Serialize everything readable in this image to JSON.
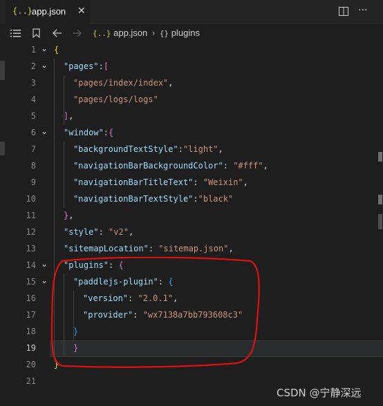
{
  "tab": {
    "icon": "json-braces-icon",
    "braces": "{..}",
    "filename": "app.json",
    "close": "✕"
  },
  "toolbar": {
    "split_icon": "split-editor-icon",
    "more": "···"
  },
  "breadcrumb": {
    "file_icon": "{..}",
    "file": "app.json",
    "symbol_icon": "{}",
    "symbol": "plugins"
  },
  "watermark": "CSDN @宁静深远",
  "highlight_color": "#e01010",
  "lines": [
    {
      "n": "1",
      "parts": [
        {
          "t": "{",
          "c": "b1"
        }
      ]
    },
    {
      "n": "2",
      "parts": [
        {
          "t": "\"pages\"",
          "c": "k"
        },
        {
          "t": ":",
          "c": "p"
        },
        {
          "t": "[",
          "c": "b2"
        }
      ]
    },
    {
      "n": "3",
      "parts": [
        {
          "t": "\"pages/index/index\"",
          "c": "s"
        },
        {
          "t": ",",
          "c": "p"
        }
      ]
    },
    {
      "n": "4",
      "parts": [
        {
          "t": "\"pages/logs/logs\"",
          "c": "s"
        }
      ]
    },
    {
      "n": "5",
      "parts": [
        {
          "t": "]",
          "c": "b2"
        },
        {
          "t": ",",
          "c": "p"
        }
      ]
    },
    {
      "n": "6",
      "parts": [
        {
          "t": "\"window\"",
          "c": "k"
        },
        {
          "t": ":",
          "c": "p"
        },
        {
          "t": "{",
          "c": "b2"
        }
      ]
    },
    {
      "n": "7",
      "parts": [
        {
          "t": "\"backgroundTextStyle\"",
          "c": "k"
        },
        {
          "t": ":",
          "c": "p"
        },
        {
          "t": "\"light\"",
          "c": "s"
        },
        {
          "t": ",",
          "c": "p"
        }
      ]
    },
    {
      "n": "8",
      "parts": [
        {
          "t": "\"navigationBarBackgroundColor\"",
          "c": "k"
        },
        {
          "t": ": ",
          "c": "p"
        },
        {
          "t": "\"#fff\"",
          "c": "s"
        },
        {
          "t": ",",
          "c": "p"
        }
      ]
    },
    {
      "n": "9",
      "parts": [
        {
          "t": "\"navigationBarTitleText\"",
          "c": "k"
        },
        {
          "t": ": ",
          "c": "p"
        },
        {
          "t": "\"Weixin\"",
          "c": "s"
        },
        {
          "t": ",",
          "c": "p"
        }
      ]
    },
    {
      "n": "10",
      "parts": [
        {
          "t": "\"navigationBarTextStyle\"",
          "c": "k"
        },
        {
          "t": ":",
          "c": "p"
        },
        {
          "t": "\"black\"",
          "c": "s"
        }
      ]
    },
    {
      "n": "11",
      "parts": [
        {
          "t": "}",
          "c": "b2"
        },
        {
          "t": ",",
          "c": "p"
        }
      ]
    },
    {
      "n": "12",
      "parts": [
        {
          "t": "\"style\"",
          "c": "k"
        },
        {
          "t": ": ",
          "c": "p"
        },
        {
          "t": "\"v2\"",
          "c": "s"
        },
        {
          "t": ",",
          "c": "p"
        }
      ]
    },
    {
      "n": "13",
      "parts": [
        {
          "t": "\"sitemapLocation\"",
          "c": "k"
        },
        {
          "t": ": ",
          "c": "p"
        },
        {
          "t": "\"sitemap.json\"",
          "c": "s"
        },
        {
          "t": ",",
          "c": "p"
        }
      ]
    },
    {
      "n": "14",
      "parts": [
        {
          "t": "\"plugins\"",
          "c": "k"
        },
        {
          "t": ": ",
          "c": "p"
        },
        {
          "t": "{",
          "c": "b2"
        }
      ]
    },
    {
      "n": "15",
      "parts": [
        {
          "t": "\"paddlejs-plugin\"",
          "c": "k"
        },
        {
          "t": ": ",
          "c": "p"
        },
        {
          "t": "{",
          "c": "b3"
        }
      ]
    },
    {
      "n": "16",
      "parts": [
        {
          "t": "\"version\"",
          "c": "k"
        },
        {
          "t": ": ",
          "c": "p"
        },
        {
          "t": "\"2.0.1\"",
          "c": "s"
        },
        {
          "t": ",",
          "c": "p"
        }
      ]
    },
    {
      "n": "17",
      "parts": [
        {
          "t": "\"provider\"",
          "c": "k"
        },
        {
          "t": ": ",
          "c": "p"
        },
        {
          "t": "\"wx7138a7bb793608c3\"",
          "c": "s"
        }
      ]
    },
    {
      "n": "18",
      "parts": [
        {
          "t": "}",
          "c": "b3"
        }
      ]
    },
    {
      "n": "19",
      "parts": [
        {
          "t": "}",
          "c": "b2"
        }
      ]
    },
    {
      "n": "20",
      "parts": [
        {
          "t": "}",
          "c": "b1"
        }
      ]
    },
    {
      "n": "21",
      "parts": []
    }
  ]
}
